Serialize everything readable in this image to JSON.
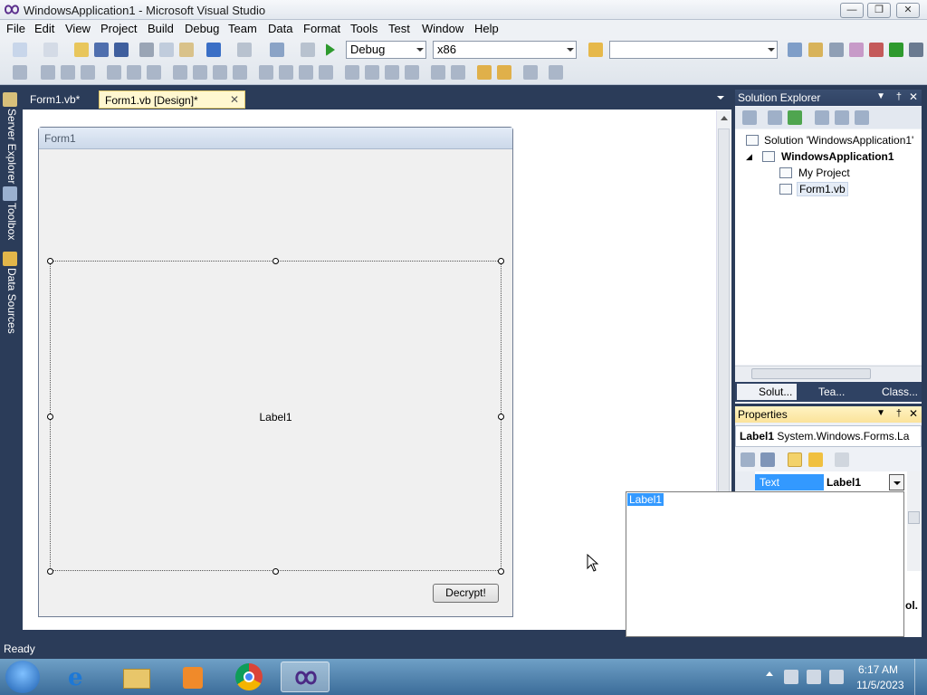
{
  "window": {
    "title": "WindowsApplication1 - Microsoft Visual Studio",
    "buttons": [
      "minimize-icon",
      "restore-icon",
      "close-icon"
    ]
  },
  "menu": [
    "File",
    "Edit",
    "View",
    "Project",
    "Build",
    "Debug",
    "Team",
    "Data",
    "Format",
    "Tools",
    "Test",
    "Window",
    "Help"
  ],
  "toolbar": {
    "config": "Debug",
    "platform": "x86",
    "find_value": ""
  },
  "side_tabs": [
    "Server Explorer",
    "Toolbox",
    "Data Sources"
  ],
  "doc_tabs": [
    {
      "label": "Form1.vb*",
      "active": false
    },
    {
      "label": "Form1.vb [Design]*",
      "active": true
    }
  ],
  "designer": {
    "form_title": "Form1",
    "label_text": "Label1",
    "button_text": "Decrypt!"
  },
  "solution_explorer": {
    "title": "Solution Explorer",
    "items": [
      {
        "label": "Solution 'WindowsApplication1'"
      },
      {
        "label": "WindowsApplication1"
      },
      {
        "label": "My Project"
      },
      {
        "label": "Form1.vb"
      }
    ],
    "bottom_tabs": [
      "Solut...",
      "Tea...",
      "Class..."
    ]
  },
  "properties": {
    "title": "Properties",
    "object_name": "Label1",
    "object_type": "System.Windows.Forms.La",
    "row_name": "Text",
    "row_value": "Label1",
    "partial_text": "ol."
  },
  "text_popup": {
    "value": "Label1"
  },
  "status": {
    "text": "Ready"
  },
  "taskbar": {
    "time": "6:17 AM",
    "date": "11/5/2023"
  },
  "colors": {
    "ide_bg": "#2b3c59",
    "selection": "#3399ff",
    "active_tab": "#fff7d0"
  }
}
